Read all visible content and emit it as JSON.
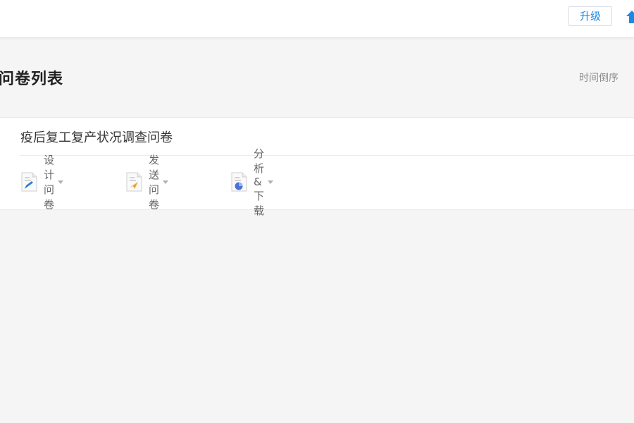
{
  "topbar": {
    "upgrade_label": "升级",
    "home_icon": "home-icon"
  },
  "header": {
    "title": "问卷列表",
    "sort_label": "时间倒序"
  },
  "survey": {
    "title": "疫后复工复产状况调查问卷",
    "actions": [
      {
        "label": "设计问卷",
        "icon": "design-doc-icon",
        "accent": "#2b7fd6"
      },
      {
        "label": "发送问卷",
        "icon": "send-doc-icon",
        "accent": "#f0a030"
      },
      {
        "label": "分析&下载",
        "icon": "analysis-doc-icon",
        "accent": "#4a72d9"
      }
    ]
  },
  "colors": {
    "brand_blue": "#1e88e5",
    "background": "#f5f5f5"
  }
}
